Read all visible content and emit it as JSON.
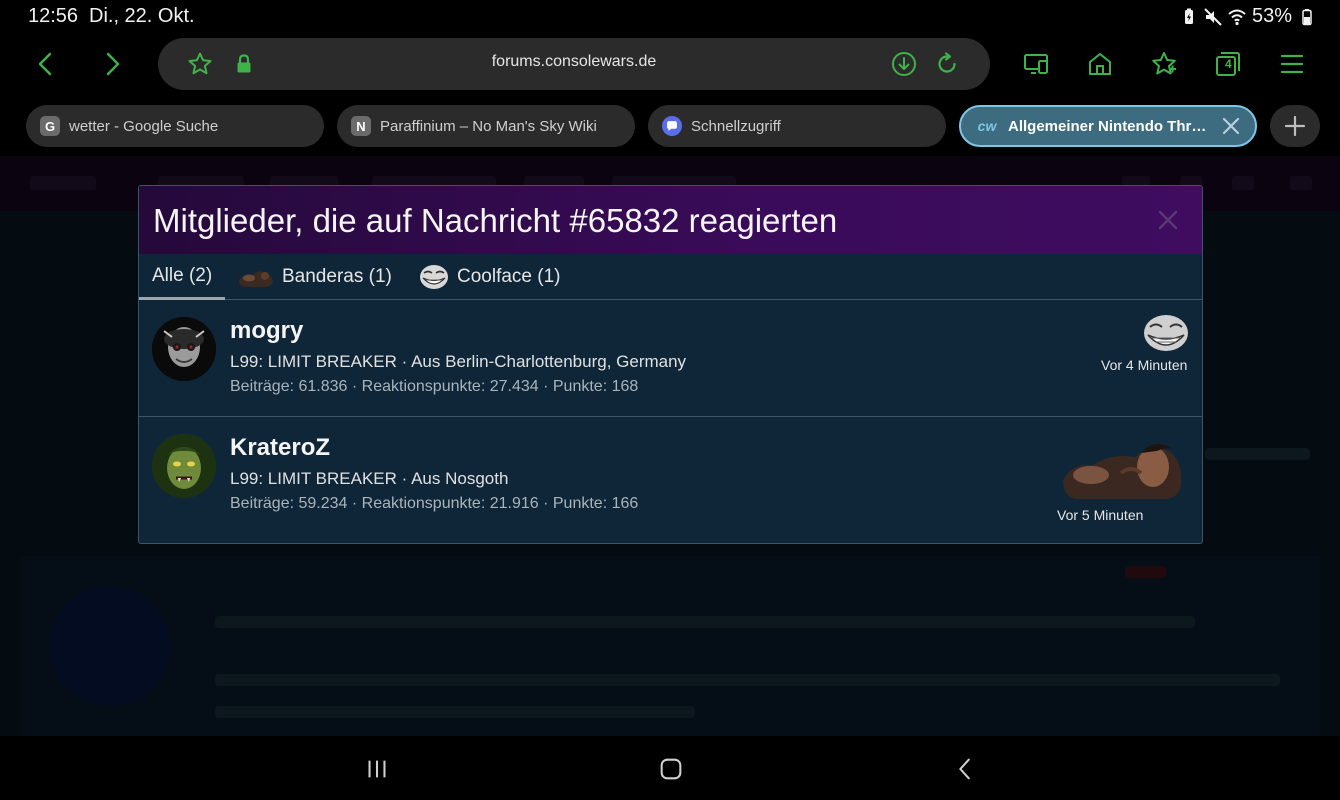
{
  "status_bar": {
    "time": "12:56",
    "date": "Di., 22. Okt.",
    "battery": "53%",
    "icons": [
      "battery-saver-icon",
      "mute-icon",
      "wifi-icon",
      "battery-icon"
    ]
  },
  "toolbar": {
    "url": "forums.consolewars.de",
    "tab_count": "4",
    "accent": "#3fb24a"
  },
  "tabs": [
    {
      "favicon": "G",
      "label": "wetter - Google Suche",
      "favicon_color": "#6b6b6b"
    },
    {
      "favicon": "N",
      "label": "Paraffinium – No Man's Sky Wiki",
      "favicon_color": "#6b6b6b"
    },
    {
      "favicon": "",
      "label": "Schnellzugriff",
      "favicon_color": "#5b6ee8"
    },
    {
      "favicon": "cw",
      "label": "Allgemeiner Nintendo Threa...",
      "favicon_color": "#7fc6e6",
      "active": true
    }
  ],
  "modal": {
    "title": "Mitglieder, die auf Nachricht #65832 reagierten",
    "filter_tabs": [
      {
        "label": "Alle (2)",
        "active": true
      },
      {
        "label": "Banderas (1)",
        "icon": "banderas-reaction-icon"
      },
      {
        "label": "Coolface (1)",
        "icon": "coolface-reaction-icon"
      }
    ],
    "members": [
      {
        "name": "mogry",
        "title_line": "L99: LIMIT BREAKER · Aus Berlin-Charlottenburg, Germany",
        "stats": "Beiträge: 61.836 · Reaktionspunkte: 27.434 · Punkte: 168",
        "time": "Vor 4 Minuten",
        "reaction": "coolface-reaction-icon"
      },
      {
        "name": "KrateroZ",
        "title_line": "L99: LIMIT BREAKER · Aus Nosgoth",
        "stats": "Beiträge: 59.234 · Reaktionspunkte: 21.916 · Punkte: 166",
        "time": "Vor 5 Minuten",
        "reaction": "banderas-reaction-icon"
      }
    ]
  }
}
